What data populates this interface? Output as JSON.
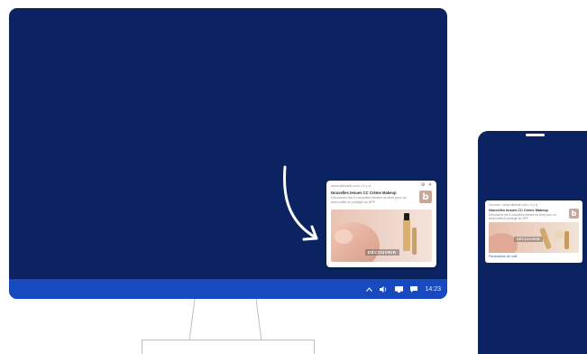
{
  "desktop": {
    "taskbar": {
      "clock": "14:23",
      "tray_icons": [
        "chevron-up-icon",
        "speaker-icon",
        "display-icon",
        "message-icon"
      ]
    },
    "notification": {
      "meta": "www.siteweb.com • Il y a",
      "title": "Nouvelles tenues CC Crème Makeup",
      "body": "Découvrez les 5 nouvelles teintes du teint pour un teint unifié et protégé au SPF",
      "brand_letter": "b",
      "cta": "DÉCOUVRIR"
    }
  },
  "phone": {
    "notification": {
      "meta": "Chrome • www.siteweb.com • il y a",
      "title": "Nouvelles tenues CC Crème Makeup",
      "body": "Découvrez les 5 nouvelles teintes du teint pour un teint unifié et protégé au SPF",
      "brand_letter": "b",
      "cta": "DÉCOUVRIR",
      "link": "Paramètres de notif."
    }
  },
  "colors": {
    "screen_bg": "#0b2461",
    "taskbar": "#1749bf",
    "brand_badge": "#c9a89a"
  }
}
